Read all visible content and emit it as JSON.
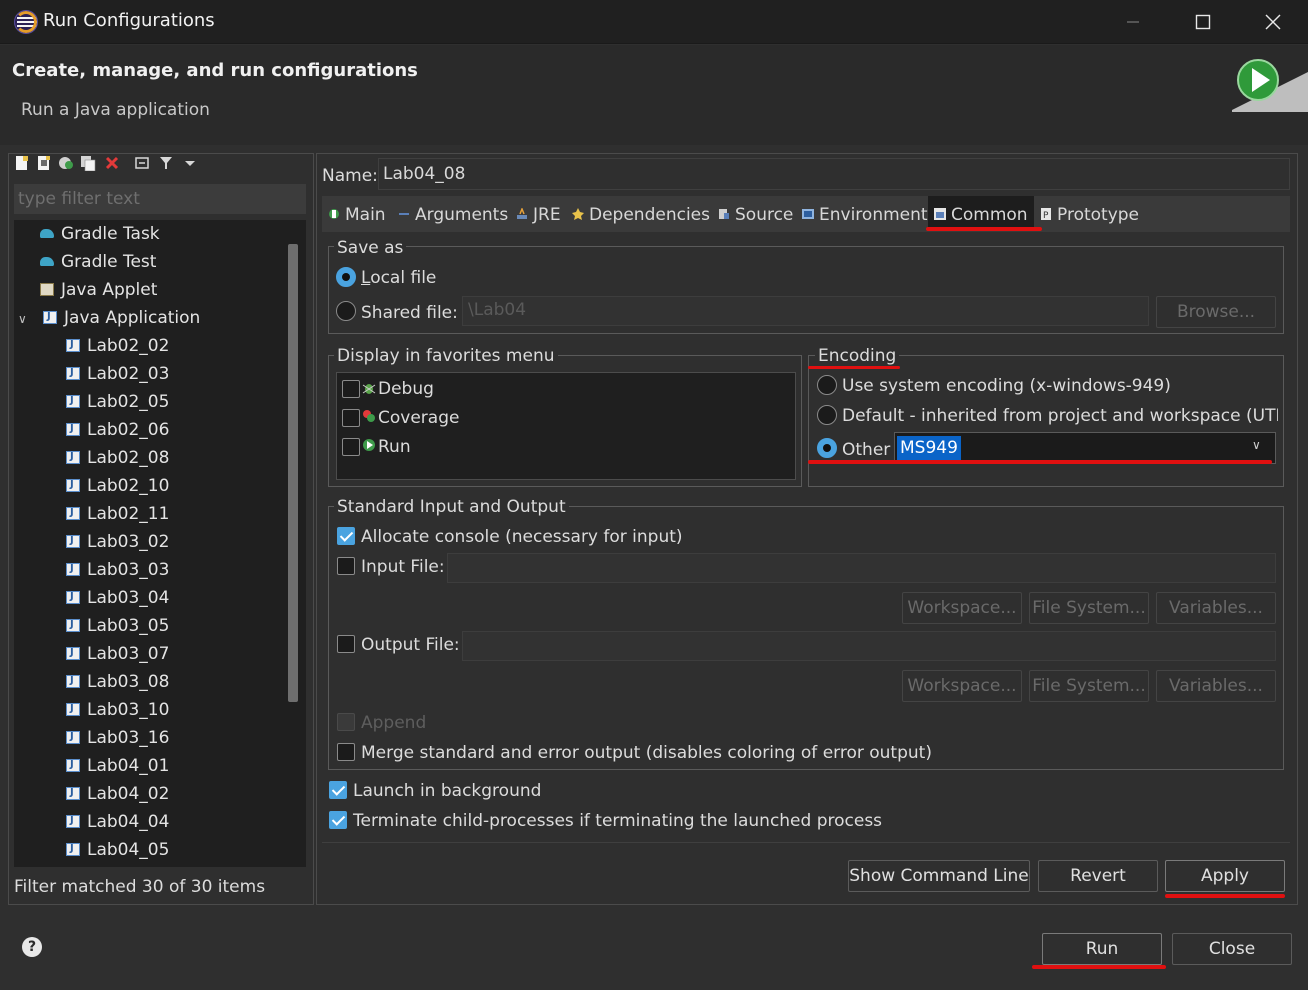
{
  "window": {
    "title": "Run Configurations",
    "minimize_icon": "minimize-icon",
    "maximize_icon": "maximize-icon",
    "close_icon": "close-icon"
  },
  "header": {
    "title": "Create, manage, and run configurations",
    "subtitle": "Run a Java application"
  },
  "sidebar": {
    "filter_placeholder": "type filter text",
    "tree": [
      {
        "label": "Gradle Task",
        "icon": "gradle-icon"
      },
      {
        "label": "Gradle Test",
        "icon": "gradle-icon"
      },
      {
        "label": "Java Applet",
        "icon": "applet-icon"
      },
      {
        "label": "Java Application",
        "icon": "java-app-icon",
        "expanded": true
      },
      {
        "label": "Lab02_02"
      },
      {
        "label": "Lab02_03"
      },
      {
        "label": "Lab02_05"
      },
      {
        "label": "Lab02_06"
      },
      {
        "label": "Lab02_08"
      },
      {
        "label": "Lab02_10"
      },
      {
        "label": "Lab02_11"
      },
      {
        "label": "Lab03_02"
      },
      {
        "label": "Lab03_03"
      },
      {
        "label": "Lab03_04"
      },
      {
        "label": "Lab03_05"
      },
      {
        "label": "Lab03_07"
      },
      {
        "label": "Lab03_08"
      },
      {
        "label": "Lab03_10"
      },
      {
        "label": "Lab03_16"
      },
      {
        "label": "Lab04_01"
      },
      {
        "label": "Lab04_02"
      },
      {
        "label": "Lab04_04"
      },
      {
        "label": "Lab04_05"
      }
    ],
    "status": "Filter matched 30 of 30 items"
  },
  "config": {
    "name_label": "Name:",
    "name_value": "Lab04_08",
    "tabs": [
      "Main",
      "Arguments",
      "JRE",
      "Dependencies",
      "Source",
      "Environment",
      "Common",
      "Prototype"
    ],
    "active_tab": "Common"
  },
  "save_as": {
    "legend": "Save as",
    "local_file": "Local file",
    "shared_file": "Shared file:",
    "shared_value": "\\Lab04",
    "browse": "Browse..."
  },
  "favorites": {
    "legend": "Display in favorites menu",
    "items": [
      "Debug",
      "Coverage",
      "Run"
    ]
  },
  "encoding": {
    "legend": "Encoding",
    "system": "Use system encoding (x-windows-949)",
    "default": "Default - inherited from project and workspace (UTF-",
    "other": "Other",
    "other_value": "MS949"
  },
  "io": {
    "legend": "Standard Input and Output",
    "allocate": "Allocate console (necessary for input)",
    "input_file": "Input File:",
    "output_file": "Output File:",
    "workspace": "Workspace...",
    "file_system": "File System...",
    "variables": "Variables...",
    "append": "Append",
    "merge": "Merge standard and error output (disables coloring of error output)"
  },
  "options": {
    "launch_bg": "Launch in background",
    "terminate": "Terminate child-processes if terminating the launched process"
  },
  "buttons": {
    "show_cmd": "Show Command Line",
    "revert": "Revert",
    "apply": "Apply",
    "run": "Run",
    "close": "Close"
  },
  "colors": {
    "accent": "#4aa3e0",
    "highlight_underline": "#e01010",
    "selection": "#0a64c8"
  }
}
